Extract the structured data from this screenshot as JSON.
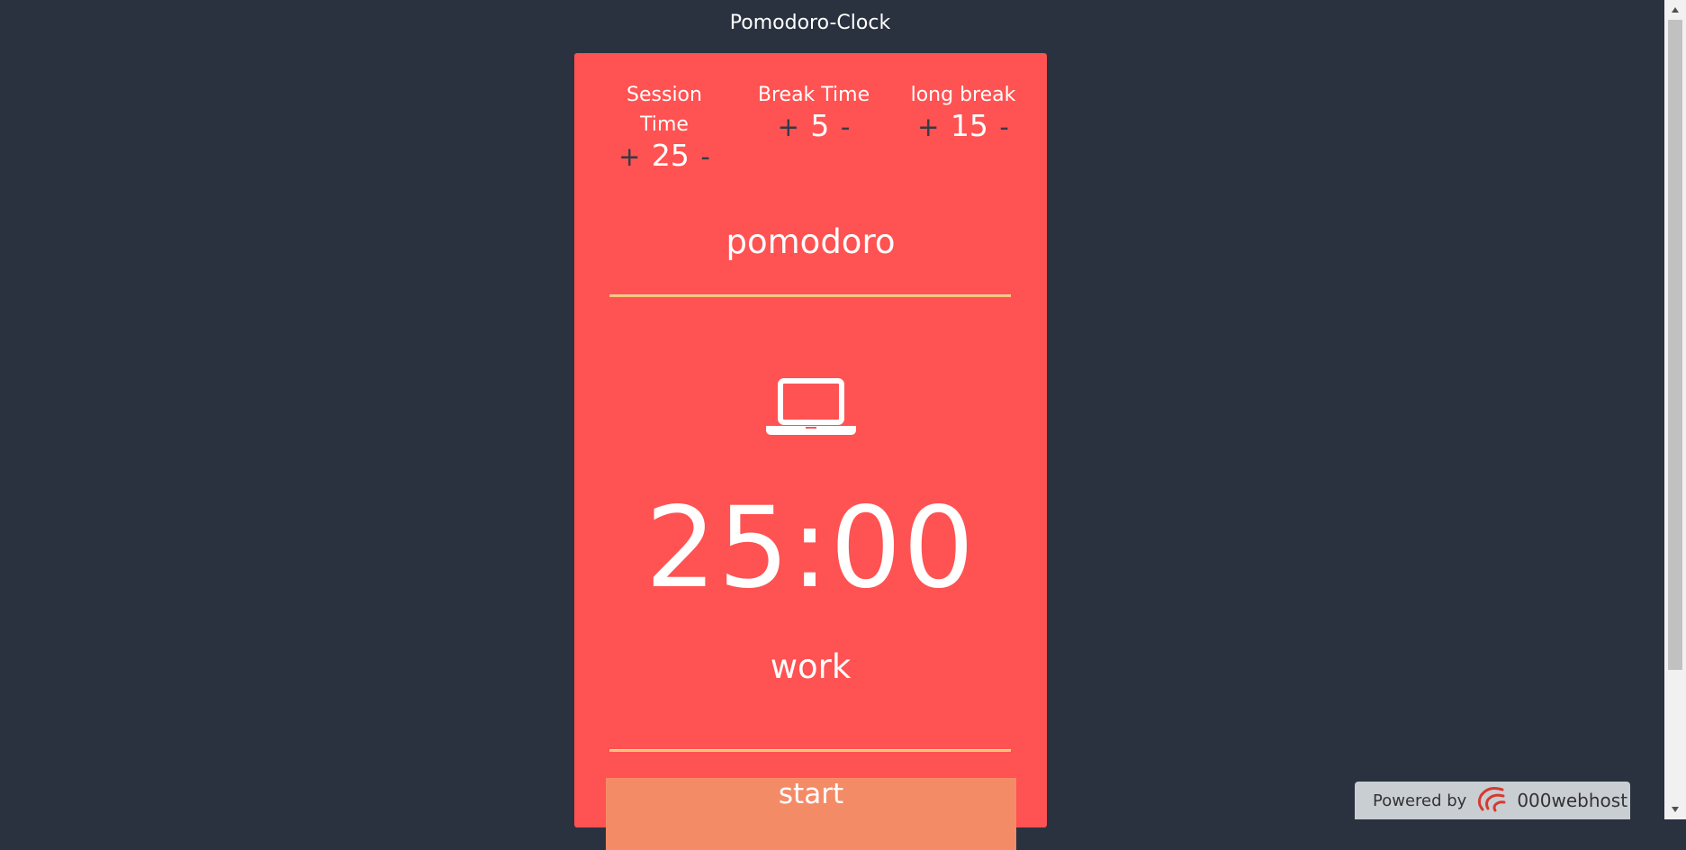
{
  "header": {
    "title": "Pomodoro-Clock"
  },
  "settings": {
    "session": {
      "label": "Session Time",
      "plus": "+",
      "value": "25",
      "minus": "-"
    },
    "break": {
      "label": "Break Time",
      "plus": "+",
      "value": "5",
      "minus": "-"
    },
    "long_break": {
      "label": "long break",
      "plus": "+",
      "value": "15",
      "minus": "-"
    }
  },
  "main": {
    "mode_title": "pomodoro",
    "icon": "laptop-icon",
    "timer": "25:00",
    "phase": "work",
    "start_label": "start"
  },
  "footer": {
    "powered_by": "Powered by",
    "brand": "000webhost"
  },
  "colors": {
    "background": "#2a3240",
    "card": "#ff5252",
    "button": "#f48b67",
    "divider": "#f6c27a"
  }
}
